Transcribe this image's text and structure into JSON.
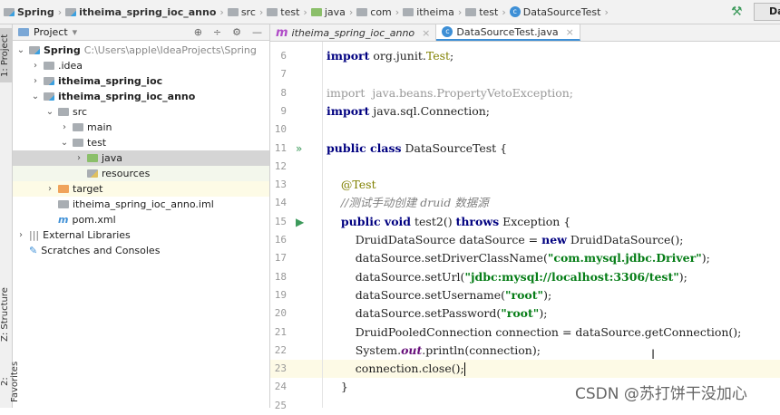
{
  "breadcrumb": [
    {
      "label": "Spring",
      "icon": "module-folder-icon",
      "bold": true
    },
    {
      "label": "itheima_spring_ioc_anno",
      "icon": "module-folder-icon",
      "bold": true
    },
    {
      "label": "src",
      "icon": "folder-icon"
    },
    {
      "label": "test",
      "icon": "folder-icon"
    },
    {
      "label": "java",
      "icon": "test-source-folder-icon"
    },
    {
      "label": "com",
      "icon": "package-icon"
    },
    {
      "label": "itheima",
      "icon": "package-icon"
    },
    {
      "label": "test",
      "icon": "package-icon"
    },
    {
      "label": "DataSourceTest",
      "icon": "class-icon"
    }
  ],
  "toolbar": {
    "run_config": "Da"
  },
  "tool_windows": {
    "project": "1: Project",
    "structure": "Z: Structure",
    "favorites": "2: Favorites"
  },
  "project_panel": {
    "title": "Project",
    "tree": [
      {
        "label": "Spring",
        "extra": "C:\\Users\\apple\\IdeaProjects\\Spring",
        "depth": 0,
        "arrow": "down",
        "icon": "mod",
        "bold": true
      },
      {
        "label": ".idea",
        "depth": 1,
        "arrow": "right",
        "icon": "folder"
      },
      {
        "label": "itheima_spring_ioc",
        "depth": 1,
        "arrow": "right",
        "icon": "mod",
        "bold": true
      },
      {
        "label": "itheima_spring_ioc_anno",
        "depth": 1,
        "arrow": "down",
        "icon": "mod",
        "bold": true
      },
      {
        "label": "src",
        "depth": 2,
        "arrow": "down",
        "icon": "folder"
      },
      {
        "label": "main",
        "depth": 3,
        "arrow": "right",
        "icon": "folder"
      },
      {
        "label": "test",
        "depth": 3,
        "arrow": "down",
        "icon": "folder"
      },
      {
        "label": "java",
        "depth": 4,
        "arrow": "right",
        "icon": "green",
        "state": "sel"
      },
      {
        "label": "resources",
        "depth": 4,
        "arrow": "",
        "icon": "res",
        "state": "hl1"
      },
      {
        "label": "target",
        "depth": 2,
        "arrow": "right",
        "icon": "orange",
        "state": "hl2"
      },
      {
        "label": "itheima_spring_ioc_anno.iml",
        "depth": 2,
        "arrow": "",
        "icon": "iml"
      },
      {
        "label": "pom.xml",
        "depth": 2,
        "arrow": "",
        "icon": "maven"
      },
      {
        "label": "External Libraries",
        "depth": 0,
        "arrow": "right",
        "icon": "lib"
      },
      {
        "label": "Scratches and Consoles",
        "depth": 0,
        "arrow": "",
        "icon": "scratch"
      }
    ]
  },
  "editor": {
    "tabs": [
      {
        "label": "itheima_spring_ioc_anno",
        "icon": "maven-icon",
        "active": false
      },
      {
        "label": "DataSourceTest.java",
        "icon": "class-icon",
        "active": true
      }
    ],
    "lines": [
      {
        "n": "6",
        "t": [
          [
            "import",
            "kw"
          ],
          " org.junit.",
          [
            "Test",
            "cls"
          ],
          ";"
        ]
      },
      {
        "n": "7",
        "t": []
      },
      {
        "n": "8",
        "t": [
          [
            "import",
            "gray"
          ],
          [
            "  java.beans.PropertyVetoException;",
            "gray"
          ]
        ]
      },
      {
        "n": "9",
        "t": [
          [
            "import",
            "kw"
          ],
          " java.sql.Connection;"
        ]
      },
      {
        "n": "10",
        "t": []
      },
      {
        "n": "11",
        "t": [
          [
            "public class",
            "kw"
          ],
          " DataSourceTest {"
        ],
        "g": "run-all"
      },
      {
        "n": "12",
        "t": []
      },
      {
        "n": "13",
        "t": [
          "    ",
          [
            "@Test",
            "ann"
          ]
        ]
      },
      {
        "n": "14",
        "t": [
          "    ",
          [
            "//测试手动创建 druid 数据源",
            "cmt"
          ]
        ]
      },
      {
        "n": "15",
        "t": [
          "    ",
          [
            "public void",
            "kw"
          ],
          " test2() ",
          [
            "throws",
            "kw"
          ],
          " Exception {"
        ],
        "g": "run"
      },
      {
        "n": "16",
        "t": [
          "        DruidDataSource dataSource = ",
          [
            "new",
            "kw"
          ],
          " DruidDataSource();"
        ]
      },
      {
        "n": "17",
        "t": [
          "        dataSource.setDriverClassName(",
          [
            "\"com.mysql.jdbc.Driver\"",
            "str"
          ],
          ");"
        ]
      },
      {
        "n": "18",
        "t": [
          "        dataSource.setUrl(",
          [
            "\"jdbc:mysql://localhost:3306/test\"",
            "str"
          ],
          ");"
        ]
      },
      {
        "n": "19",
        "t": [
          "        dataSource.setUsername(",
          [
            "\"root\"",
            "str"
          ],
          ");"
        ]
      },
      {
        "n": "20",
        "t": [
          "        dataSource.setPassword(",
          [
            "\"root\"",
            "str"
          ],
          ");"
        ]
      },
      {
        "n": "21",
        "t": [
          "        DruidPooledConnection connection = dataSource.getConnection();"
        ]
      },
      {
        "n": "22",
        "t": [
          "        System.",
          [
            "out",
            "st"
          ],
          ".println(connection);"
        ]
      },
      {
        "n": "23",
        "t": [
          "        connection.close();"
        ],
        "cur": true
      },
      {
        "n": "24",
        "t": [
          "    }"
        ]
      },
      {
        "n": "25",
        "t": []
      }
    ]
  },
  "watermark": "CSDN @苏打饼干没加心"
}
